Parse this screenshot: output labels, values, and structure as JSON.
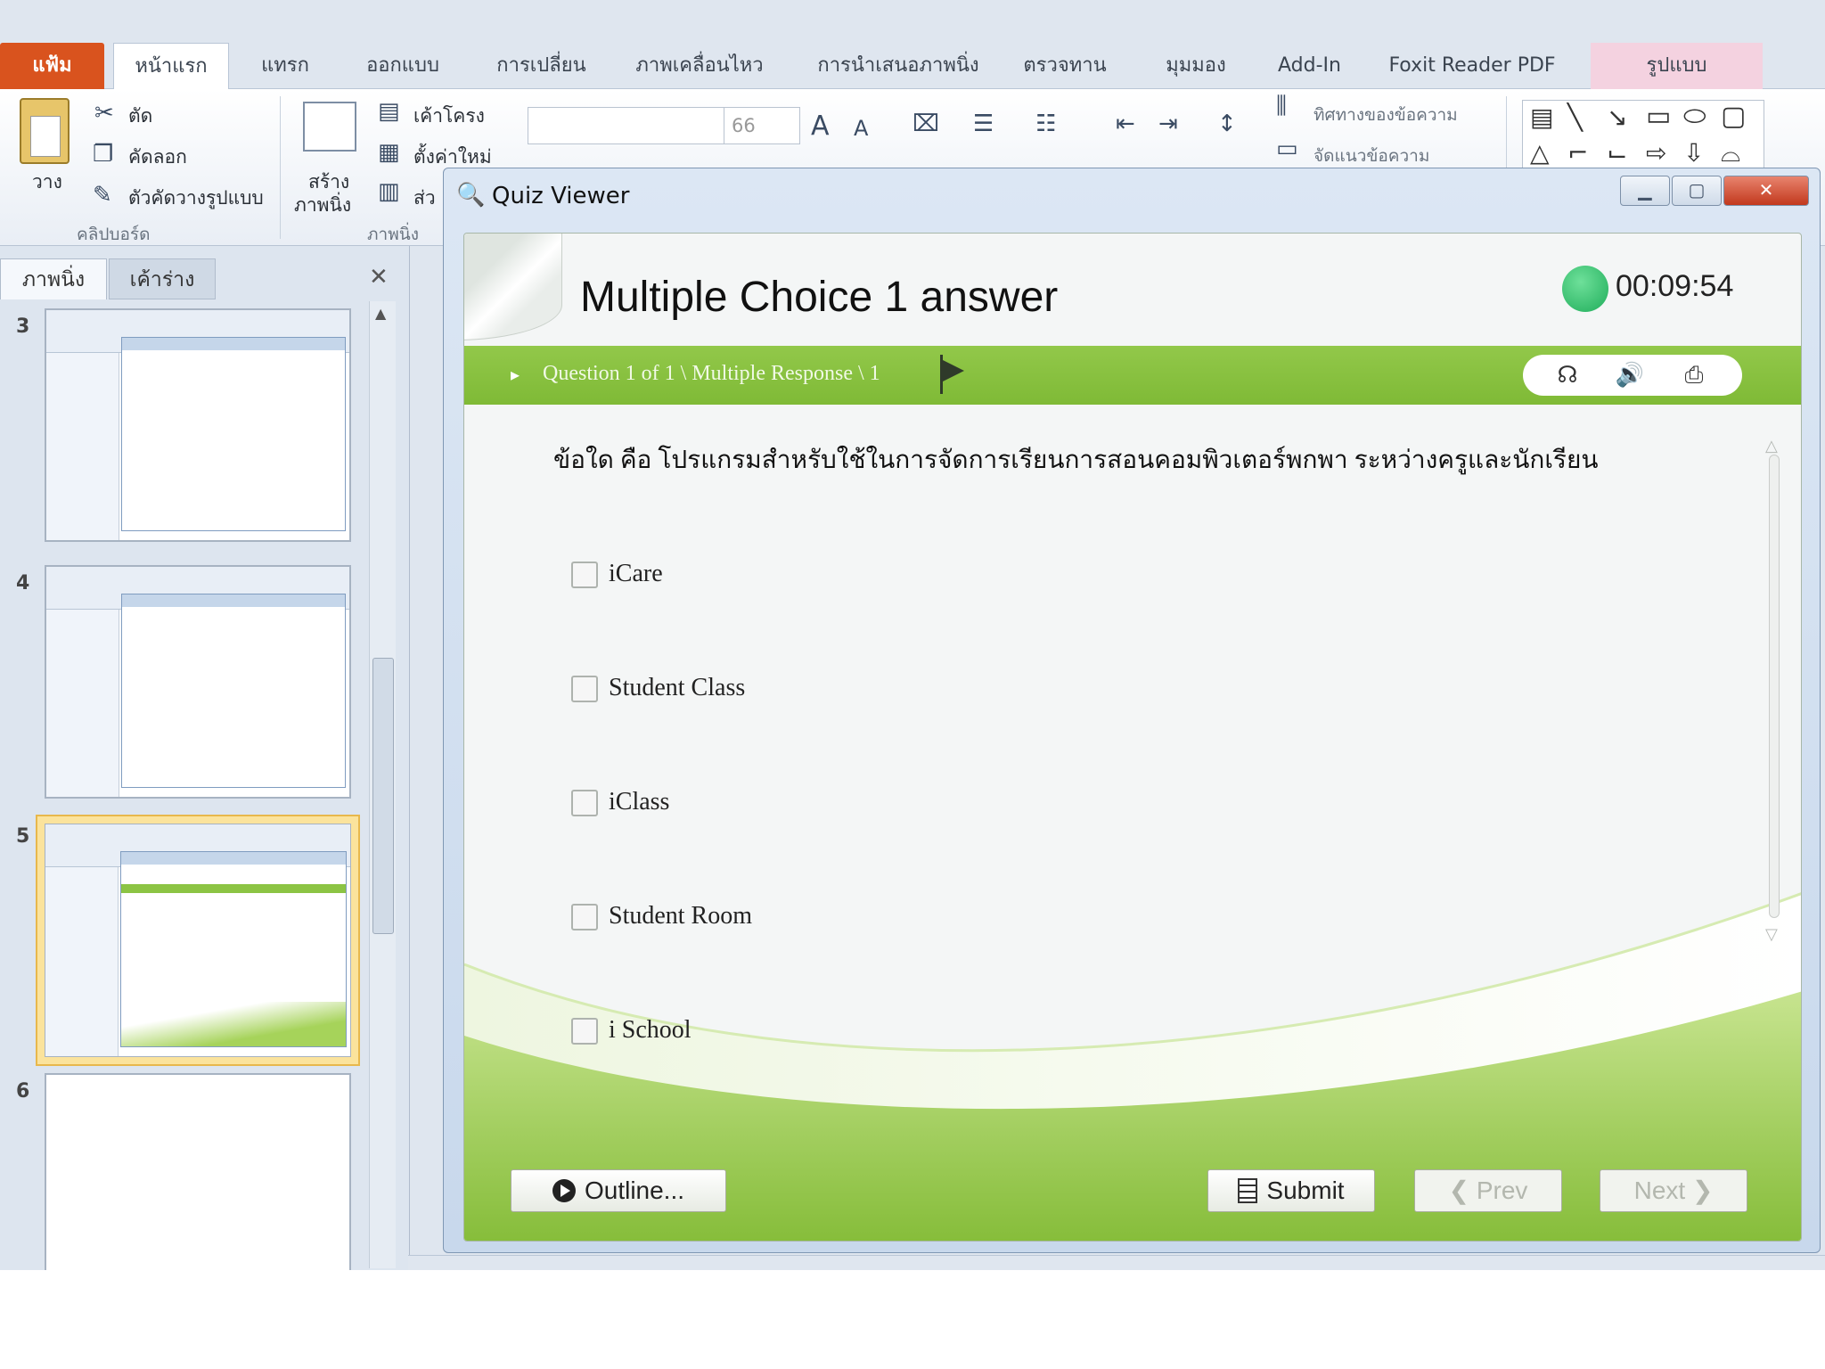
{
  "ribbon": {
    "tabs": [
      "แฟ้ม",
      "หน้าแรก",
      "แทรก",
      "ออกแบบ",
      "การเปลี่ยน",
      "ภาพเคลื่อนไหว",
      "การนำเสนอภาพนิ่ง",
      "ตรวจทาน",
      "มุมมอง",
      "Add-In",
      "Foxit Reader PDF",
      "รูปแบบ"
    ],
    "clipboard": {
      "paste": "วาง",
      "cut": "ตัด",
      "copy": "คัดลอก",
      "format_painter": "ตัวคัดวางรูปแบบ",
      "group_label": "คลิปบอร์ด"
    },
    "slides": {
      "new_slide_line1": "สร้าง",
      "new_slide_line2": "ภาพนิ่ง",
      "layout": "เค้าโครง",
      "reset": "ตั้งค่าใหม่",
      "section": "ส่ว",
      "group_label": "ภาพนิ่ง"
    },
    "font": {
      "size": "66"
    },
    "paragraph": {
      "text_direction": "ทิศทางของข้อความ",
      "align_text": "จัดแนวข้อความ"
    }
  },
  "pane": {
    "tabs": [
      "ภาพนิ่ง",
      "เค้าร่าง"
    ],
    "close": "✕",
    "slide_numbers": [
      "3",
      "4",
      "5",
      "6"
    ],
    "selected_slide": "5"
  },
  "quiz_viewer": {
    "window_title": "Quiz Viewer",
    "title": "Multiple Choice 1 answer",
    "timer": "00:09:54",
    "breadcrumb": "Question 1 of 1 \\ Multiple Response \\ 1",
    "question": "ข้อใด คือ โปรแกรมสำหรับใช้ในการจัดการเรียนการสอนคอมพิวเตอร์พกพา ระหว่างครูและนักเรียน",
    "options": [
      "iCare",
      "Student Class",
      "iClass",
      "Student Room",
      "i School"
    ],
    "buttons": {
      "outline": "Outline...",
      "submit": "Submit",
      "prev": "❮ Prev",
      "next": "Next ❯"
    }
  }
}
